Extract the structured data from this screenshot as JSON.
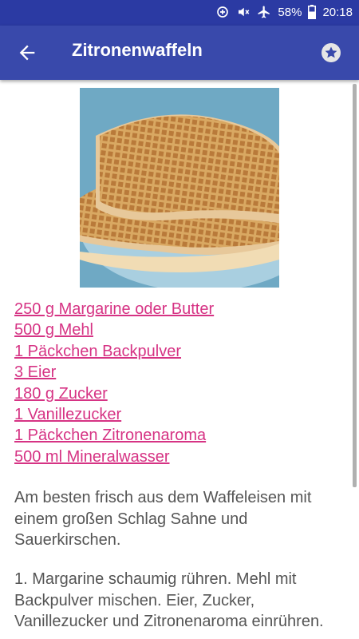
{
  "status": {
    "battery": "58%",
    "time": "20:18"
  },
  "appbar": {
    "title": "Zitronenwaffeln"
  },
  "recipe": {
    "ingredients": [
      "250 g Margarine oder Butter",
      "500 g Mehl",
      "1 Päckchen Backpulver",
      "3 Eier",
      "180 g Zucker",
      "1 Vanillezucker",
      "1 Päckchen Zitronenaroma",
      "500 ml Mineralwasser"
    ],
    "intro": "Am besten frisch aus dem Waffeleisen mit einem großen Schlag Sahne und Sauerkirschen.",
    "step1": "1. Margarine schaumig rühren. Mehl mit Backpulver mischen. Eier, Zucker, Vanillezucker und Zitronenaroma einrühren."
  },
  "colors": {
    "appbar": "#3949ab",
    "statusbar": "#2b3aa3",
    "link": "#d63384"
  }
}
